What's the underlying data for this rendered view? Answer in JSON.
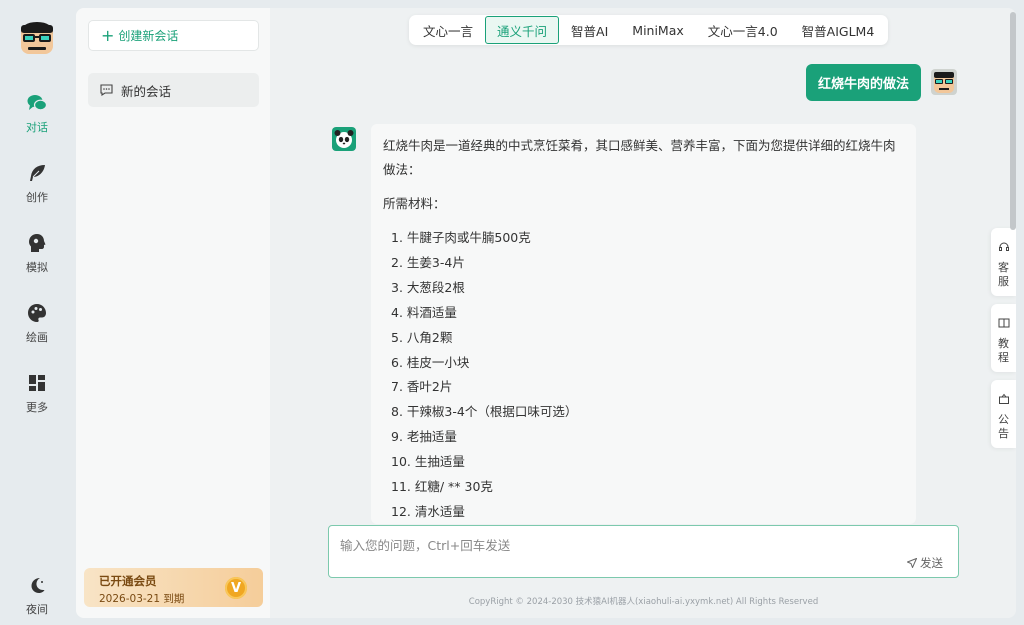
{
  "rail": {
    "items": [
      {
        "label": "对话",
        "icon": "chat-bubbles-icon",
        "active": true
      },
      {
        "label": "创作",
        "icon": "feather-icon",
        "active": false
      },
      {
        "label": "模拟",
        "icon": "profile-head-icon",
        "active": false
      },
      {
        "label": "绘画",
        "icon": "palette-icon",
        "active": false
      },
      {
        "label": "更多",
        "icon": "grid-icon",
        "active": false
      }
    ],
    "night": {
      "label": "夜间",
      "icon": "moon-icon"
    }
  },
  "sessions": {
    "new_chat_label": "创建新会话",
    "items": [
      {
        "label": "新的会话"
      }
    ]
  },
  "vip": {
    "title": "已开通会员",
    "expiry": "2026-03-21 到期",
    "badge": "V"
  },
  "model_tabs": [
    {
      "label": "文心一言",
      "active": false
    },
    {
      "label": "通义千问",
      "active": true
    },
    {
      "label": "智普AI",
      "active": false
    },
    {
      "label": "MiniMax",
      "active": false
    },
    {
      "label": "文心一言4.0",
      "active": false
    },
    {
      "label": "智普AIGLM4",
      "active": false
    }
  ],
  "conversation": {
    "user_message": "红烧牛肉的做法",
    "answer_intro": "红烧牛肉是一道经典的中式烹饪菜肴，其口感鲜美、营养丰富，下面为您提供详细的红烧牛肉做法：",
    "materials_heading": "所需材料：",
    "materials": [
      "1. 牛腱子肉或牛腩500克",
      "2. 生姜3-4片",
      "3. 大葱段2根",
      "4. 料酒适量",
      "5. 八角2颗",
      "6. 桂皮一小块",
      "7. 香叶2片",
      "8. 干辣椒3-4个（根据口味可选）",
      "9. 老抽适量",
      "10. 生抽适量",
      "11. 红糖/ ** 30克",
      "12. 清水适量"
    ]
  },
  "input": {
    "placeholder": "输入您的问题，Ctrl+回车发送",
    "value": "",
    "send_label": "发送"
  },
  "footer": "CopyRight © 2024-2030 技术猿AI机器人(xiaohuli-ai.yxymk.net) All Rights Reserved",
  "side_tabs": [
    {
      "label": "客服",
      "icon": "headset-icon"
    },
    {
      "label": "教程",
      "icon": "book-icon"
    },
    {
      "label": "公告",
      "icon": "notice-icon"
    }
  ],
  "colors": {
    "accent": "#1aa179",
    "vip_bg": "#f5cd9a"
  }
}
